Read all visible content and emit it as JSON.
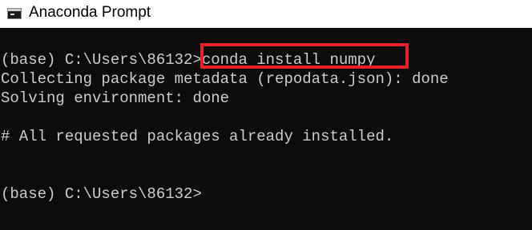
{
  "window": {
    "title": "Anaconda Prompt",
    "icon": "terminal-icon"
  },
  "console": {
    "command_prompt": "(base) C:\\Users\\86132>",
    "command": "conda install numpy",
    "line_collecting": "Collecting package metadata (repodata.json): done",
    "line_solving": "Solving environment: done",
    "line_installed": "# All requested packages already installed.",
    "final_prompt": "(base) C:\\Users\\86132>"
  },
  "colors": {
    "console_background": "#0c0c0c",
    "console_text": "#cccccc",
    "highlight_border": "#e8202a",
    "titlebar_background": "#ffffff"
  }
}
